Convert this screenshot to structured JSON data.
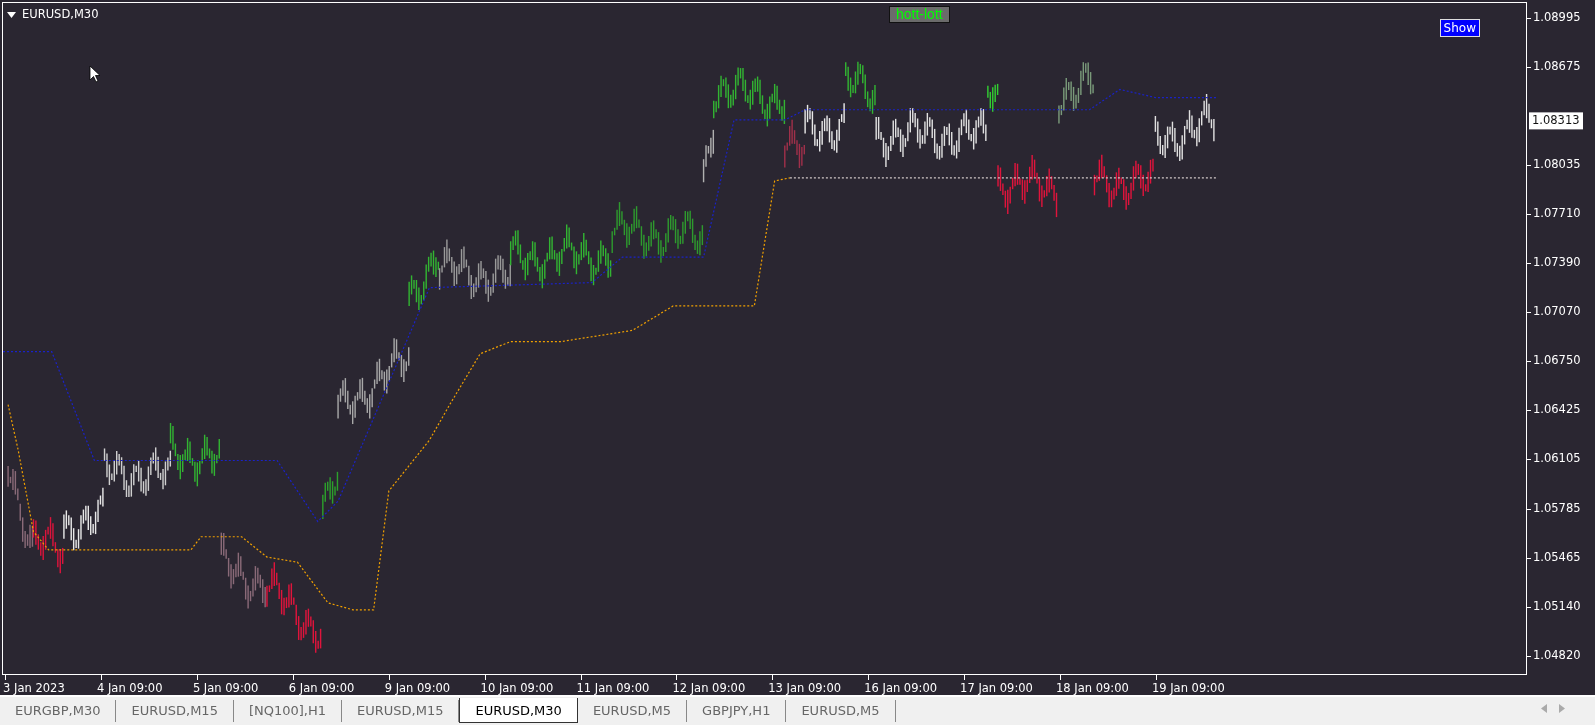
{
  "chart": {
    "title": "EURUSD,M30",
    "indicator_label": "hott-lott",
    "show_button": "Show",
    "current_price": "1.08313",
    "price_axis": [
      "1.08995",
      "1.08675",
      "1.08035",
      "1.07710",
      "1.07390",
      "1.07070",
      "1.06750",
      "1.06425",
      "1.06105",
      "1.05785",
      "1.05465",
      "1.05140",
      "1.04820"
    ],
    "time_axis": [
      "3 Jan 2023",
      "4 Jan 09:00",
      "5 Jan 09:00",
      "6 Jan 09:00",
      "9 Jan 09:00",
      "10 Jan 09:00",
      "11 Jan 09:00",
      "12 Jan 09:00",
      "13 Jan 09:00",
      "16 Jan 09:00",
      "17 Jan 09:00",
      "18 Jan 09:00",
      "19 Jan 09:00"
    ]
  },
  "tabs": [
    {
      "label": "EURGBP,M30",
      "selected": false
    },
    {
      "label": "EURUSD,M15",
      "selected": false
    },
    {
      "label": "[NQ100],H1",
      "selected": false
    },
    {
      "label": "EURUSD,M15",
      "selected": false
    },
    {
      "label": "EURUSD,M30",
      "selected": true
    },
    {
      "label": "EURUSD,M5",
      "selected": false
    },
    {
      "label": "GBPJPY,H1",
      "selected": false
    },
    {
      "label": "EURUSD,M5",
      "selected": false
    }
  ]
}
